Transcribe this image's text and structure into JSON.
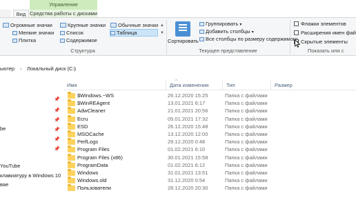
{
  "ribbon_tabs": {
    "context_header": "Управление",
    "file": "",
    "view": "Вид",
    "disk_tools": "Средства работы с дисками"
  },
  "layout_group": {
    "label": "Структура",
    "items": [
      "Огромные значки",
      "Крупные значки",
      "Обычные значки",
      "Мелкие значки",
      "Список",
      "Таблица",
      "Плитка",
      "Содержимое"
    ],
    "selected": "Таблица"
  },
  "current_view_group": {
    "label": "Текущее представление",
    "sort_label": "Сортировать",
    "group_by": "Группировать",
    "add_columns": "Добавить столбцы",
    "fit_columns": "Все столбцы по размеру содержимого"
  },
  "show_hide_group": {
    "label": "Показать или с",
    "item_checkboxes": {
      "label": "Флажки элементов",
      "checked": false
    },
    "file_extensions": {
      "label": "Расширения имен файло",
      "checked": false
    },
    "hidden_items": {
      "label": "Скрытые элементы",
      "checked": true
    }
  },
  "address_bar": {
    "crumbs": [
      "ьютер",
      "Локальный диск (C:)"
    ],
    "separators": [
      "›",
      "›",
      "›"
    ]
  },
  "nav_pane": {
    "items": [
      "be",
      "YouTube",
      "клавиатуру в Windows 10",
      "вае"
    ],
    "pins": [
      "📌",
      "📌",
      "📌",
      "📌",
      "📌",
      "📌"
    ]
  },
  "file_list": {
    "columns": {
      "name": "Имя",
      "date": "Дата изменения",
      "type": "Тип",
      "size": "Размер"
    },
    "sort_indicator": "^",
    "rows": [
      {
        "name": "$Windows.~WS",
        "date": "26.12.2020 15:25",
        "type": "Папка с файлами"
      },
      {
        "name": "$WinREAgent",
        "date": "13.01.2021 6:17",
        "type": "Папка с файлами"
      },
      {
        "name": "AdwCleaner",
        "date": "21.01.2021 20:56",
        "type": "Папка с файлами"
      },
      {
        "name": "Ecru",
        "date": "05.01.2021 17:32",
        "type": "Папка с файлами"
      },
      {
        "name": "ESD",
        "date": "26.12.2020 15:48",
        "type": "Папка с файлами"
      },
      {
        "name": "MSOCache",
        "date": "13.12.2020 12:00",
        "type": "Папка с файлами"
      },
      {
        "name": "PerfLogs",
        "date": "29.12.2020 0:48",
        "type": "Папка с файлами"
      },
      {
        "name": "Program Files",
        "date": "01.02.2021 6:10",
        "type": "Папка с файлами"
      },
      {
        "name": "Program Files (x86)",
        "date": "30.01.2021 15:58",
        "type": "Папка с файлами"
      },
      {
        "name": "ProgramData",
        "date": "01.02.2021 6:12",
        "type": "Папка с файлами"
      },
      {
        "name": "Windows",
        "date": "31.01.2021 13:51",
        "type": "Папка с файлами"
      },
      {
        "name": "Windows.old",
        "date": "31.12.2020 0:54",
        "type": "Папка с файлами"
      },
      {
        "name": "Пользователи",
        "date": "28.12.2020 20:30",
        "type": "Папка с файлами"
      }
    ]
  }
}
